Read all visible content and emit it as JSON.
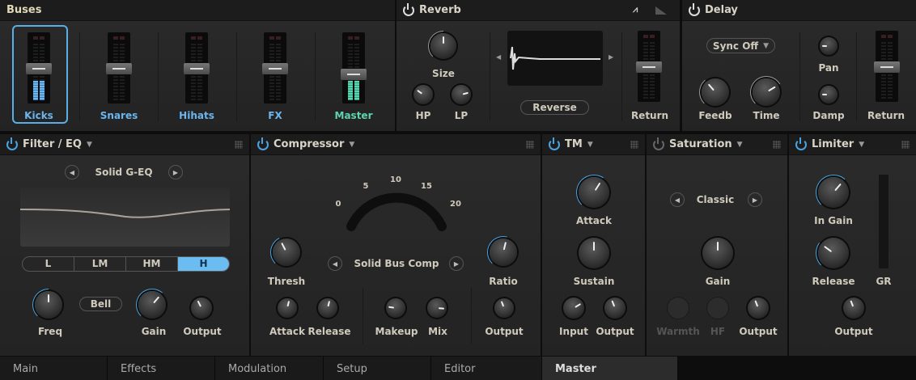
{
  "buses": {
    "title": "Buses",
    "channels": [
      {
        "label": "Kicks",
        "color": "#6bb6ee",
        "fader": 0.62,
        "meter": 0.35,
        "selected": true
      },
      {
        "label": "Snares",
        "color": "#6bb6ee",
        "fader": 0.62,
        "meter": 0
      },
      {
        "label": "Hihats",
        "color": "#6bb6ee",
        "fader": 0.62,
        "meter": 0
      },
      {
        "label": "FX",
        "color": "#6bb6ee",
        "fader": 0.62,
        "meter": 0
      },
      {
        "label": "Master",
        "color": "#5fd3b0",
        "fader": 0.5,
        "meter": 0.35,
        "green": true
      }
    ]
  },
  "reverb": {
    "title": "Reverb",
    "size": "Size",
    "hp": "HP",
    "lp": "LP",
    "reverse": "Reverse",
    "return": "Return",
    "return_level": 0.62
  },
  "delay": {
    "title": "Delay",
    "sync": "Sync Off",
    "feedb": "Feedb",
    "time": "Time",
    "pan": "Pan",
    "damp": "Damp",
    "return": "Return",
    "return_level": 0.62
  },
  "filter": {
    "title": "Filter / EQ",
    "preset": "Solid G-EQ",
    "bands": [
      "L",
      "LM",
      "HM",
      "H"
    ],
    "active_band": "H",
    "mode": "Bell",
    "freq": "Freq",
    "gain": "Gain",
    "output": "Output"
  },
  "compressor": {
    "title": "Compressor",
    "scale": [
      "0",
      "5",
      "10",
      "15",
      "20"
    ],
    "gr_value": 0.05,
    "thresh": "Thresh",
    "preset": "Solid Bus Comp",
    "ratio": "Ratio",
    "attack": "Attack",
    "release": "Release",
    "makeup": "Makeup",
    "mix": "Mix",
    "output": "Output"
  },
  "tm": {
    "title": "TM",
    "attack": "Attack",
    "sustain": "Sustain",
    "input": "Input",
    "output": "Output"
  },
  "saturation": {
    "title": "Saturation",
    "preset": "Classic",
    "gain": "Gain",
    "warmth": "Warmth",
    "hf": "HF",
    "output": "Output"
  },
  "limiter": {
    "title": "Limiter",
    "in_gain": "In Gain",
    "release": "Release",
    "gr": "GR",
    "output": "Output"
  },
  "knobs": {
    "rv_size": {
      "v": 0.5,
      "arc": "#999"
    },
    "rv_hp": {
      "v": 0.3
    },
    "rv_lp": {
      "v": 0.78
    },
    "dl_feedb": {
      "v": 0.35,
      "arc": "#999"
    },
    "dl_time": {
      "v": 0.72,
      "arc": "#999"
    },
    "dl_pan": {
      "v": 0.17
    },
    "dl_damp": {
      "v": 0.17
    },
    "eq_freq": {
      "v": 0.5,
      "arc": "#4aa3e0"
    },
    "eq_gain": {
      "v": 0.65,
      "arc": "#4aa3e0"
    },
    "eq_out": {
      "v": 0.4
    },
    "cp_thresh": {
      "v": 0.4,
      "arc": "#4aa3e0"
    },
    "cp_ratio": {
      "v": 0.55,
      "arc": "#4aa3e0"
    },
    "cp_attack": {
      "v": 0.55
    },
    "cp_release": {
      "v": 0.55
    },
    "cp_makeup": {
      "v": 0.2
    },
    "cp_mix": {
      "v": 0.85
    },
    "cp_out": {
      "v": 0.42
    },
    "tm_attack": {
      "v": 0.62,
      "arc": "#4aa3e0"
    },
    "tm_sustain": {
      "v": 0.5
    },
    "tm_input": {
      "v": 0.72
    },
    "tm_out": {
      "v": 0.42
    },
    "st_gain": {
      "v": 0.5
    },
    "st_warmth": {
      "v": 0
    },
    "st_hf": {
      "v": 0
    },
    "st_out": {
      "v": 0.42
    },
    "lm_in": {
      "v": 0.65,
      "arc": "#4aa3e0"
    },
    "lm_release": {
      "v": 0.3,
      "arc": "#4aa3e0"
    },
    "lm_out": {
      "v": 0.42
    }
  },
  "tabs": [
    {
      "label": "Main"
    },
    {
      "label": "Effects"
    },
    {
      "label": "Modulation"
    },
    {
      "label": "Setup"
    },
    {
      "label": "Editor"
    },
    {
      "label": "Master",
      "selected": true
    }
  ]
}
